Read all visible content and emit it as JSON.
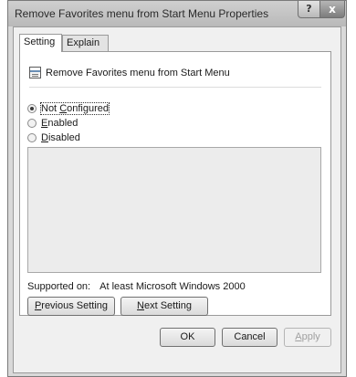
{
  "window": {
    "title": "Remove Favorites menu from Start Menu Properties",
    "help_label": "?",
    "close_label": "x"
  },
  "tabs": [
    {
      "label": "Setting",
      "active": true
    },
    {
      "label": "Explain",
      "active": false
    }
  ],
  "policy": {
    "name": "Remove Favorites menu from Start Menu",
    "icon": "policy-setting-icon"
  },
  "options": {
    "not_configured": {
      "prefix": "Not ",
      "accel": "C",
      "rest": "onfigured",
      "checked": true
    },
    "enabled": {
      "accel": "E",
      "rest": "nabled",
      "checked": false
    },
    "disabled": {
      "accel": "D",
      "rest": "isabled",
      "checked": false
    }
  },
  "supported": {
    "label": "Supported on:",
    "value": "At least Microsoft Windows 2000"
  },
  "nav": {
    "previous": {
      "accel": "P",
      "rest": "revious Setting"
    },
    "next": {
      "accel": "N",
      "rest": "ext Setting"
    }
  },
  "dialog_buttons": {
    "ok": "OK",
    "cancel": "Cancel",
    "apply_accel": "A",
    "apply_rest": "pply"
  }
}
